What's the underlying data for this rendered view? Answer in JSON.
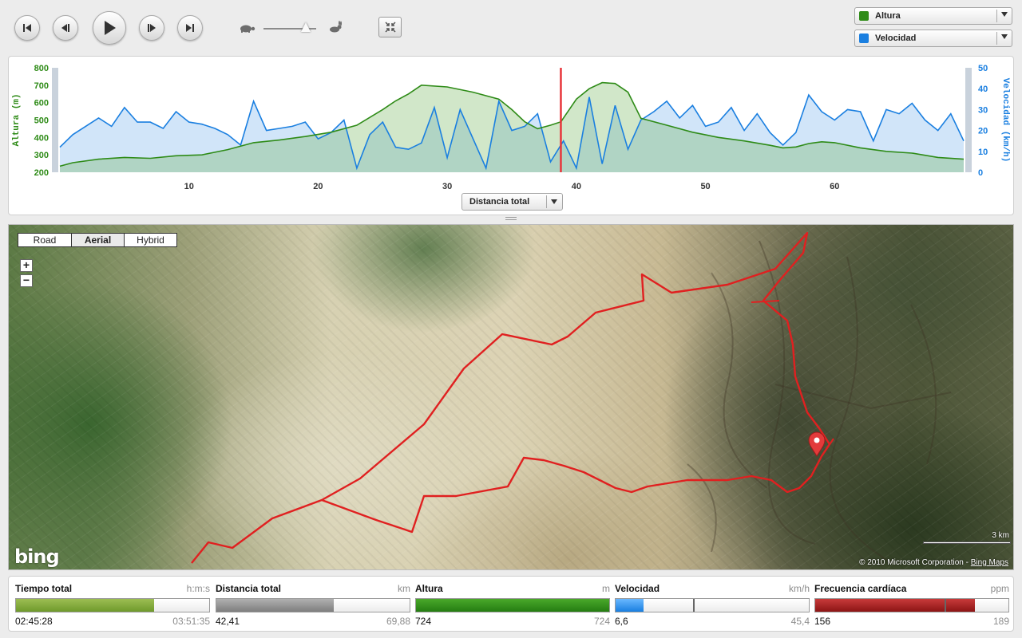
{
  "playback": {
    "buttons": [
      "first",
      "previous",
      "play",
      "next",
      "last"
    ],
    "speed_level": 0.8
  },
  "series_selectors": [
    {
      "label": "Altura",
      "color": "#2e8b17"
    },
    {
      "label": "Velocidad",
      "color": "#1a7fe0"
    }
  ],
  "chart_data": {
    "type": "area",
    "xlabel": "",
    "x_ticks": [
      "10",
      "20",
      "30",
      "40",
      "50",
      "60"
    ],
    "x_range": [
      0,
      70
    ],
    "cursor_x": 38.8,
    "y_left": {
      "label": "Altura (m)",
      "ticks": [
        "200",
        "300",
        "400",
        "500",
        "600",
        "700",
        "800"
      ],
      "range": [
        200,
        800
      ],
      "color": "#2e8b17"
    },
    "y_right": {
      "label": "Velocidad (km/h)",
      "ticks": [
        "0",
        "10",
        "20",
        "30",
        "40",
        "50"
      ],
      "range": [
        0,
        50
      ],
      "color": "#1a7fe0"
    },
    "series": [
      {
        "name": "Altura",
        "color": "#2e8b17",
        "x": [
          0,
          1,
          3,
          5,
          7,
          9,
          11,
          13,
          15,
          17,
          19,
          21,
          23,
          25,
          26,
          27,
          28,
          30,
          32,
          34,
          35,
          36,
          37,
          38,
          38.8,
          40,
          41,
          42,
          43,
          44,
          45,
          47,
          49,
          51,
          53,
          55,
          56,
          57,
          58,
          59,
          60,
          62,
          64,
          66,
          68,
          70
        ],
        "values": [
          235,
          255,
          275,
          285,
          280,
          295,
          300,
          330,
          370,
          385,
          405,
          430,
          470,
          560,
          610,
          650,
          700,
          690,
          660,
          620,
          560,
          490,
          450,
          470,
          490,
          620,
          680,
          715,
          710,
          660,
          510,
          470,
          430,
          400,
          380,
          355,
          340,
          345,
          365,
          375,
          370,
          340,
          320,
          310,
          285,
          275
        ]
      },
      {
        "name": "Velocidad",
        "color": "#1a7fe0",
        "x": [
          0,
          1,
          2,
          3,
          4,
          5,
          6,
          7,
          8,
          9,
          10,
          11,
          12,
          13,
          14,
          15,
          16,
          17,
          18,
          19,
          20,
          21,
          22,
          23,
          24,
          25,
          26,
          27,
          28,
          29,
          30,
          31,
          32,
          33,
          34,
          35,
          36,
          37,
          38,
          39,
          40,
          41,
          42,
          43,
          44,
          45,
          46,
          47,
          48,
          49,
          50,
          51,
          52,
          53,
          54,
          55,
          56,
          57,
          58,
          59,
          60,
          61,
          62,
          63,
          64,
          65,
          66,
          67,
          68,
          69,
          70
        ],
        "values": [
          12,
          18,
          22,
          26,
          22,
          31,
          24,
          24,
          21,
          29,
          24,
          23,
          21,
          18,
          13,
          34,
          20,
          21,
          22,
          24,
          16,
          19,
          25,
          2,
          18,
          24,
          12,
          11,
          14,
          31,
          7,
          30,
          16,
          2,
          34,
          20,
          22,
          28,
          5,
          15,
          2,
          36,
          4,
          32,
          11,
          25,
          29,
          34,
          26,
          32,
          22,
          24,
          31,
          20,
          28,
          19,
          13,
          19,
          37,
          29,
          25,
          30,
          29,
          15,
          30,
          28,
          33,
          25,
          20,
          28,
          15
        ]
      }
    ]
  },
  "x_axis_selector": {
    "label": "Distancia total"
  },
  "map": {
    "types": [
      "Road",
      "Aerial",
      "Hybrid"
    ],
    "selected_type": "Aerial",
    "zoom_in": "+",
    "zoom_out": "−",
    "logo": "bing",
    "scale_label": "3 km",
    "copyright": "© 2010 Microsoft Corporation",
    "copyright_link": "Bing Maps"
  },
  "stats": [
    {
      "name": "Tiempo total",
      "unit": "h:m:s",
      "current": "02:45:28",
      "max": "03:51:35",
      "fraction": 0.714,
      "color_a": "#9cbd52",
      "color_b": "#6f9a2c"
    },
    {
      "name": "Distancia total",
      "unit": "km",
      "current": "42,41",
      "max": "69,88",
      "fraction": 0.607,
      "color_a": "#b0b0b0",
      "color_b": "#7e7e7e"
    },
    {
      "name": "Altura",
      "unit": "m",
      "current": "724",
      "max": "724",
      "fraction": 1.0,
      "color_a": "#49a82a",
      "color_b": "#257d12"
    },
    {
      "name": "Velocidad",
      "unit": "km/h",
      "current": "6,6",
      "max": "45,4",
      "fraction": 0.145,
      "marker": 0.4,
      "color_a": "#6ab8ff",
      "color_b": "#1a7fe0"
    },
    {
      "name": "Frecuencia cardíaca",
      "unit": "ppm",
      "current": "156",
      "max": "189",
      "fraction": 0.825,
      "marker": 0.67,
      "color_a": "#c83a3a",
      "color_b": "#8c1515"
    }
  ]
}
